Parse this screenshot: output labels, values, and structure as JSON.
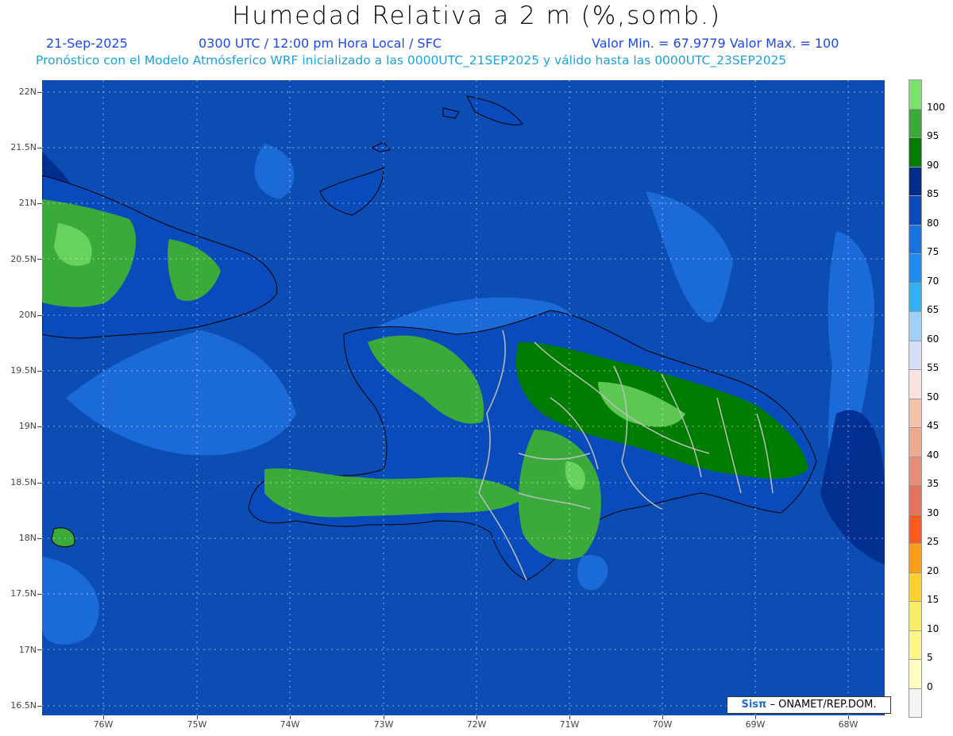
{
  "header": {
    "title": "Humedad Relativa a 2 m (%,somb.)",
    "date": "21-Sep-2025",
    "time": "0300 UTC / 12:00 pm Hora Local / SFC",
    "min_max": "Valor Min. = 67.9779  Valor Max. = 100",
    "description": "Pronóstico con el Modelo Atmósferico WRF inicializado a las 0000UTC_21SEP2025 y válido hasta las  0000UTC_23SEP2025"
  },
  "axes": {
    "lat_labels": [
      "22N",
      "21.5N",
      "21N",
      "20.5N",
      "20N",
      "19.5N",
      "19N",
      "18.5N",
      "18N",
      "17.5N",
      "17N",
      "16.5N"
    ],
    "lon_labels": [
      "76W",
      "75W",
      "74W",
      "73W",
      "72W",
      "71W",
      "70W",
      "69W",
      "68W"
    ]
  },
  "legend": {
    "labels": [
      "100",
      "95",
      "90",
      "85",
      "80",
      "75",
      "70",
      "65",
      "60",
      "55",
      "50",
      "45",
      "40",
      "35",
      "30",
      "25",
      "20",
      "15",
      "10",
      "5",
      "0"
    ],
    "colors": [
      "#7be26e",
      "#3aab3a",
      "#007d00",
      "#002c8c",
      "#0a4bbb",
      "#1773df",
      "#1f8cef",
      "#33b0f5",
      "#9fd0f8",
      "#d7def8",
      "#fbe2e2",
      "#f6c2a9",
      "#eeaa8f",
      "#e88e78",
      "#e3725f",
      "#fc5a1f",
      "#fd9d17",
      "#fdd02e",
      "#f8ee66",
      "#fdf686",
      "#fefec0",
      "#f4f4f4"
    ]
  },
  "credit": {
    "brand": "Sisπ",
    "text": "– ONAMET/REP.DOM."
  },
  "colors": {
    "sea_deep": "#0c4db3",
    "sea_mid": "#1a6bd8",
    "sea_light": "#2b8cf0",
    "land_low": "#007d00",
    "land_mid": "#3aab3a",
    "land_high": "#7be26e",
    "border": "#bdbdbd",
    "coast": "#000000"
  }
}
